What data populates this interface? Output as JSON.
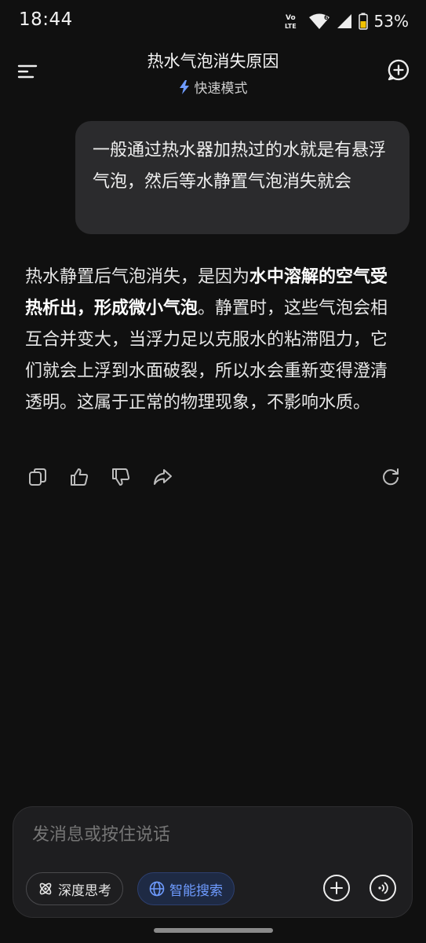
{
  "status_bar": {
    "time": "18:44",
    "network_badge_top": "Vo",
    "network_badge_bottom": "LTE",
    "wifi_badge": "6",
    "battery_percent": "53%"
  },
  "header": {
    "title": "热水气泡消失原因",
    "mode_label": "快速模式",
    "menu_icon": "menu-icon",
    "new_chat_icon": "new-chat-icon"
  },
  "conversation": {
    "user_message": "一般通过热水器加热过的水就是有悬浮气泡，然后等水静置气泡消失就会",
    "assistant_reply": {
      "part1": "热水静置后气泡消失，是因为",
      "bold": "水中溶解的空气受热析出，形成微小气泡",
      "part2": "。静置时，这些气泡会相互合并变大，当浮力足以克服水的粘滞阻力，它们就会上浮到水面破裂，所以水会重新变得澄清透明。这属于正常的物理现象，不影响水质。"
    },
    "actions": [
      "copy-icon",
      "thumbs-up-icon",
      "thumbs-down-icon",
      "share-icon",
      "regenerate-icon"
    ]
  },
  "composer": {
    "placeholder": "发消息或按住说话",
    "deep_think_label": "深度思考",
    "smart_search_label": "智能搜索",
    "accent_color": "#6E9BFF"
  }
}
